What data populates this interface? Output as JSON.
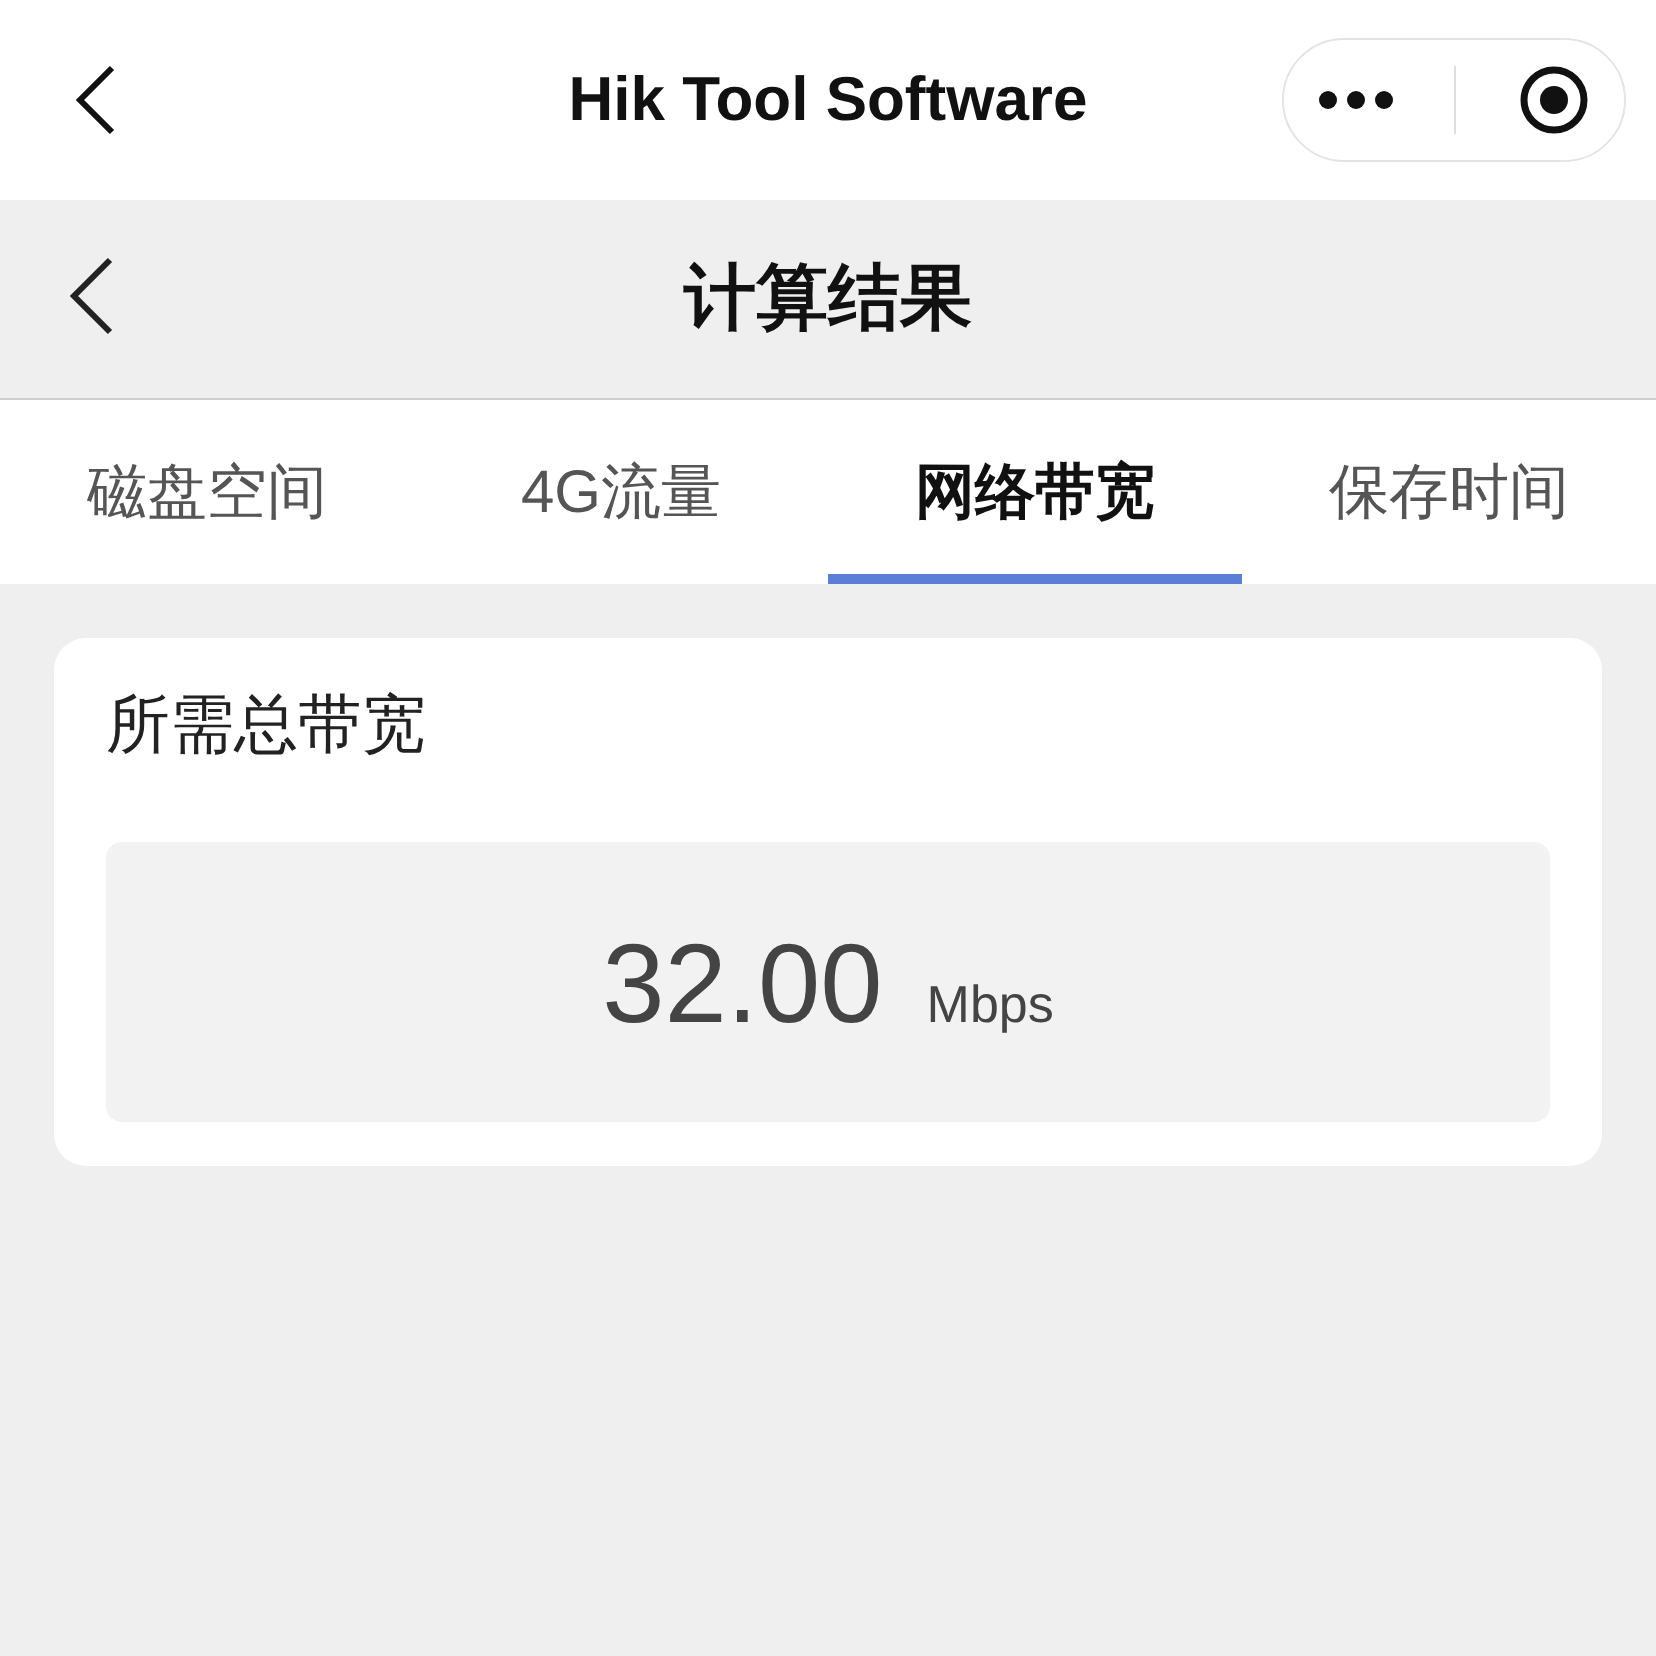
{
  "mini_program_bar": {
    "title": "Hik Tool Software"
  },
  "page_header": {
    "title": "计算结果"
  },
  "tabs": [
    {
      "label": "磁盘空间",
      "selected": false
    },
    {
      "label": "4G流量",
      "selected": false
    },
    {
      "label": "网络带宽",
      "selected": true
    },
    {
      "label": "保存时间",
      "selected": false
    }
  ],
  "result": {
    "label": "所需总带宽",
    "value": "32.00",
    "unit": "Mbps"
  }
}
